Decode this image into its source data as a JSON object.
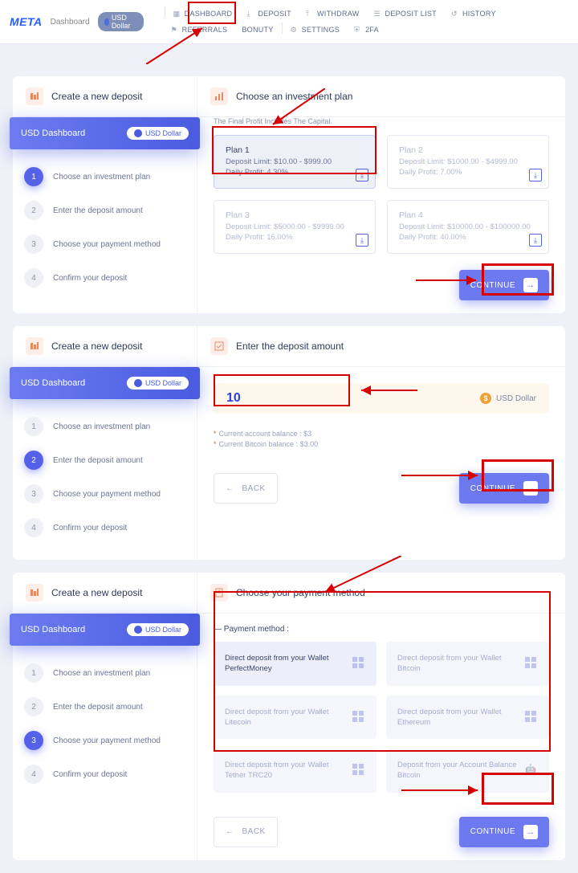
{
  "brand": "META",
  "breadcrumb": "Dashboard",
  "topCurrencyPill": "USD Dollar",
  "nav": [
    "DASHBOARD",
    "DEPOSIT",
    "WITHDRAW",
    "DEPOSIT LIST",
    "HISTORY",
    "REFERRALS",
    "BONUTY",
    "SETTINGS",
    "2FA"
  ],
  "leftPanel": {
    "header": "Create a new deposit",
    "bannerTitle": "USD Dashboard",
    "bannerPill": "USD Dollar",
    "steps": [
      "Choose an investment plan",
      "Enter the deposit amount",
      "Choose your payment method",
      "Confirm your deposit"
    ]
  },
  "section1": {
    "title": "Choose an investment plan",
    "subtitle": "The Final Profit Includes The Capital.",
    "plans": [
      {
        "name": "Plan 1",
        "limit": "Deposit Limit: $10.00 - $999.00",
        "profit": "Daily Profit: 4.30%"
      },
      {
        "name": "Plan 2",
        "limit": "Deposit Limit: $1000.00 - $4999.00",
        "profit": "Daily Profit: 7.00%"
      },
      {
        "name": "Plan 3",
        "limit": "Deposit Limit: $5000.00 - $9999.00",
        "profit": "Daily Profit: 16.00%"
      },
      {
        "name": "Plan 4",
        "limit": "Deposit Limit: $10000.00 - $100000.00",
        "profit": "Daily Profit: 40.00%"
      }
    ],
    "continue": "CONTINUE"
  },
  "section2": {
    "title": "Enter the deposit amount",
    "amount": "10",
    "currency": "USD Dollar",
    "balance1": "Current account balance : $3",
    "balance2": "Current Bitcoin balance : $3.00",
    "back": "BACK",
    "continue": "CONTINUE"
  },
  "section3": {
    "title": "Choose your payment method",
    "subhead": "— Payment method :",
    "options": [
      {
        "l1": "Direct deposit from your Wallet",
        "l2": "PerfectMoney"
      },
      {
        "l1": "Direct deposit from your Wallet",
        "l2": "Bitcoin"
      },
      {
        "l1": "Direct deposit from your Wallet",
        "l2": "Litecoin"
      },
      {
        "l1": "Direct deposit from your Wallet",
        "l2": "Ethereum"
      },
      {
        "l1": "Direct deposit from your Wallet",
        "l2": "Tether TRC20"
      },
      {
        "l1": "Deposit from your Account Balance",
        "l2": "Bitcoin"
      }
    ],
    "back": "BACK",
    "continue": "CONTINUE"
  }
}
